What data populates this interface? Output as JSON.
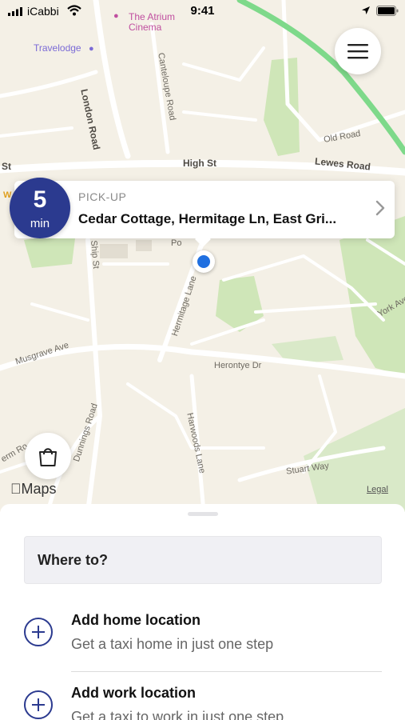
{
  "status_bar": {
    "carrier": "iCabbi",
    "time": "9:41"
  },
  "map": {
    "labels": {
      "poi_atrium_line1": "The Atrium",
      "poi_atrium_line2": "Cinema",
      "poi_travelodge": "Travelodge",
      "london_road": "London Road",
      "canteloupe_road": "Canteloupe Road",
      "old_road": "Old Road",
      "high_st": "High St",
      "lewes_road": "Lewes Road",
      "st": "St",
      "ship_st": "Ship St",
      "hermitage_lane": "Hermitage Lane",
      "musgrave_ave": "Musgrave Ave",
      "york_ave": "York Ave",
      "herontye_dr": "Herontye Dr",
      "dunnings_road": "Dunnings Road",
      "harwoods_lane": "Harwoods Lane",
      "stuart_way": "Stuart Way",
      "erm_ro": "erm Ro",
      "w": "W",
      "po": "Po"
    },
    "credit": "Maps",
    "legal": "Legal"
  },
  "pickup": {
    "eta_value": "5",
    "eta_unit": "min",
    "label": "PICK-UP",
    "address": "Cedar Cottage, Hermitage Ln, East Gri..."
  },
  "sheet": {
    "where_to": "Where to?",
    "items": [
      {
        "title": "Add home location",
        "subtitle": "Get a taxi home in just one step"
      },
      {
        "title": "Add work location",
        "subtitle": "Get a taxi to work in just one step"
      }
    ]
  },
  "colors": {
    "brand": "#2b3a8f",
    "user_dot": "#1f6fe0",
    "map_bg": "#f4f0e6",
    "park": "#cfe6b8",
    "route": "#7ed98a"
  }
}
